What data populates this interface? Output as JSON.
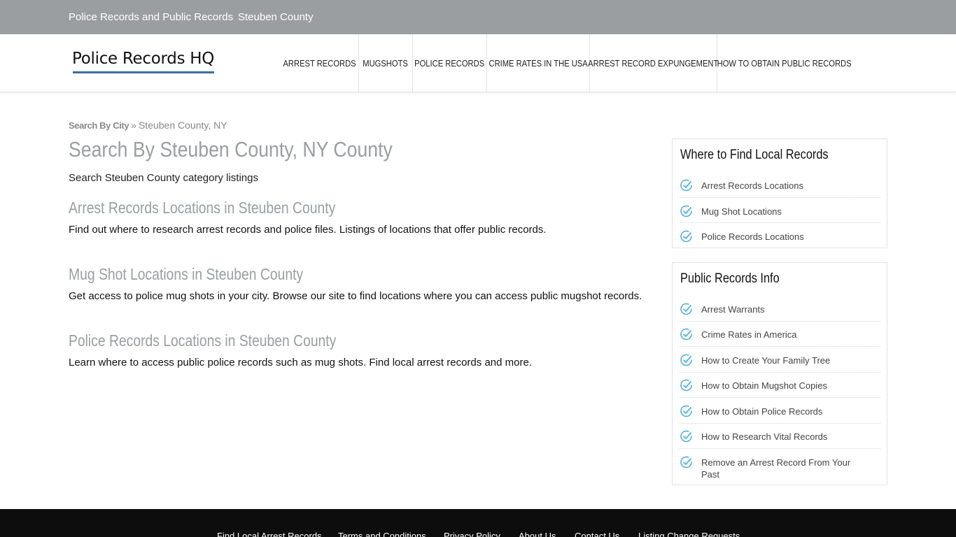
{
  "topbar": {
    "links": [
      "Police Records and Public Records",
      "Steuben County"
    ]
  },
  "header": {
    "logo": "Police Records HQ",
    "nav": [
      "ARREST RECORDS",
      "MUGSHOTS",
      "POLICE RECORDS",
      "CRIME RATES IN THE USA",
      "ARREST RECORD EXPUNGEMENT",
      "HOW TO OBTAIN PUBLIC RECORDS"
    ]
  },
  "breadcrumb": {
    "link": "Search By City",
    "separator": "»",
    "current": "Steuben County, NY"
  },
  "main": {
    "title": "Search By Steuben County, NY County",
    "lead": "Search Steuben County category listings",
    "sections": [
      {
        "title": "Arrest Records Locations in Steuben County",
        "desc": "Find out where to research arrest records and police files. Listings of locations that offer public records."
      },
      {
        "title": "Mug Shot Locations in Steuben County",
        "desc": "Get access to police mug shots in your city. Browse our site to find locations where you can access public mugshot records."
      },
      {
        "title": "Police Records Locations in Steuben County",
        "desc": "Learn where to access public police records such as mug shots. Find local arrest records and more."
      }
    ]
  },
  "sidebar": {
    "widgets": [
      {
        "title": "Where to Find Local Records",
        "items": [
          "Arrest Records Locations",
          "Mug Shot Locations",
          "Police Records Locations"
        ]
      },
      {
        "title": "Public Records Info",
        "items": [
          "Arrest Warrants",
          "Crime Rates in America",
          "How to Create Your Family Tree",
          "How to Obtain Mugshot Copies",
          "How to Obtain Police Records",
          "How to Research Vital Records",
          "Remove an Arrest Record From Your Past"
        ]
      }
    ],
    "icon": "check-circle-icon",
    "icon_color": "#4fb3d9"
  },
  "footer": {
    "links": [
      "Find Local Arrest Records",
      "Terms and Conditions",
      "Privacy Policy",
      "About Us",
      "Contact Us",
      "Listing Change Requests"
    ]
  },
  "colors": {
    "topbar": "#9a9ea1",
    "footer": "#0d0d0d",
    "heading_gray": "#9a9ea1",
    "logo_underline": "#3a6ea5"
  }
}
